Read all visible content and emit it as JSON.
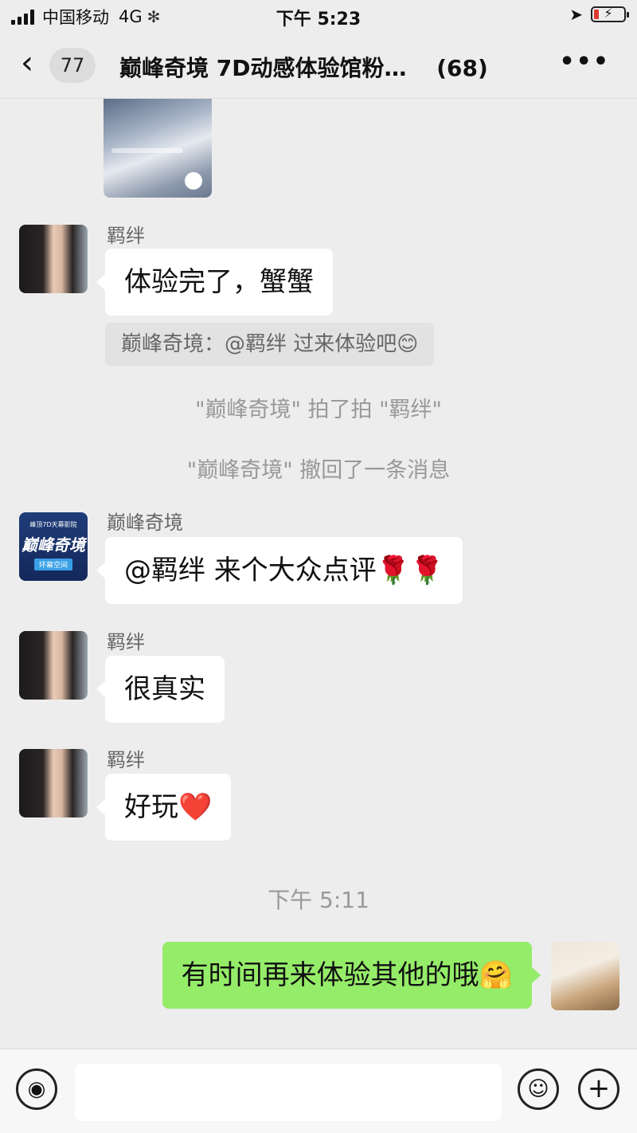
{
  "status_bar": {
    "carrier": "中国移动",
    "network": "4G",
    "time": "下午 5:23"
  },
  "nav": {
    "unread_count": "77",
    "title": "巅峰奇境 7D动感体验馆粉…",
    "member_count": "(68)"
  },
  "messages": [
    {
      "sender": "羁绊",
      "text": "体验完了，蟹蟹"
    },
    {
      "quote": "巅峰奇境：@羁绊 过来体验吧😊"
    },
    {
      "system": "\"巅峰奇境\" 拍了拍 \"羁绊\""
    },
    {
      "system": "\"巅峰奇境\" 撤回了一条消息"
    },
    {
      "sender": "巅峰奇境",
      "text": "@羁绊 来个大众点评🌹🌹"
    },
    {
      "sender": "羁绊",
      "text": "很真实"
    },
    {
      "sender": "羁绊",
      "text": "好玩❤️"
    },
    {
      "timestamp": "下午 5:11"
    },
    {
      "self": true,
      "text": "有时间再来体验其他的哦🤗"
    }
  ],
  "brand_avatar": {
    "top": "峰顶7D天幕影院",
    "name": "巅峰奇境",
    "sub": "环幕空间"
  },
  "colors": {
    "chat_bg": "#ededed",
    "self_bubble": "#95ec69",
    "other_bubble": "#ffffff"
  },
  "icons": [
    "signal-icon",
    "location-icon",
    "battery-icon",
    "back-icon",
    "more-icon",
    "voice-icon",
    "emoji-icon",
    "plus-icon"
  ]
}
